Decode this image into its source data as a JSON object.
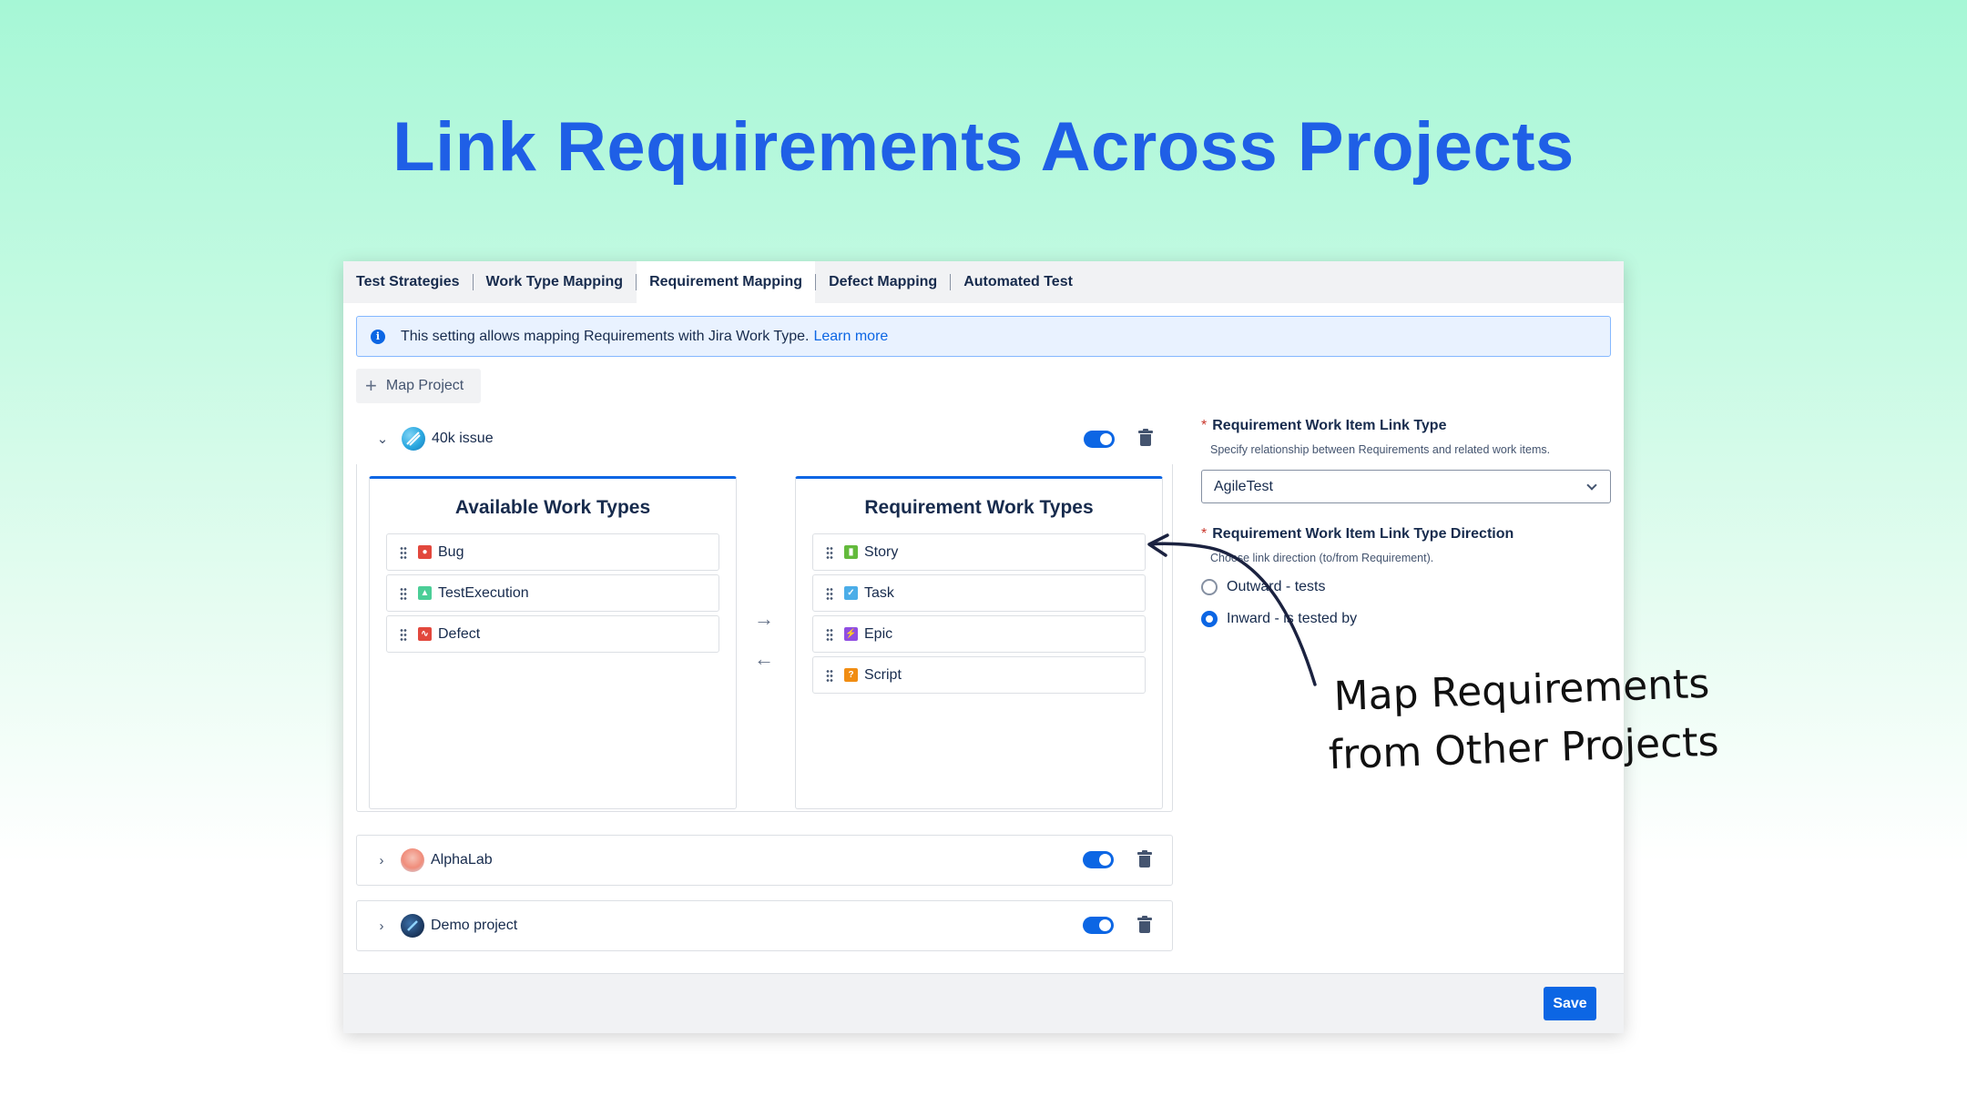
{
  "headline": "Link Requirements Across Projects",
  "tabs": [
    {
      "label": "Test Strategies",
      "active": false
    },
    {
      "label": "Work Type Mapping",
      "active": false
    },
    {
      "label": "Requirement Mapping",
      "active": true
    },
    {
      "label": "Defect Mapping",
      "active": false
    },
    {
      "label": "Automated Test",
      "active": false
    }
  ],
  "info_banner": {
    "text": "This setting allows mapping Requirements with Jira Work Type.",
    "link": "Learn more",
    "icon": "info-icon"
  },
  "map_project_button": "Map Project",
  "projects": [
    {
      "name": "40k issue",
      "expanded": true,
      "enabled": true
    },
    {
      "name": "AlphaLab",
      "expanded": false,
      "enabled": true
    },
    {
      "name": "Demo project",
      "expanded": false,
      "enabled": true
    }
  ],
  "available_work_types": {
    "title": "Available Work Types",
    "items": [
      {
        "label": "Bug",
        "icon": "bug-icon",
        "color": "#e2483d"
      },
      {
        "label": "TestExecution",
        "icon": "test-execution-icon",
        "color": "#4bce97"
      },
      {
        "label": "Defect",
        "icon": "defect-icon",
        "color": "#e2483d"
      }
    ]
  },
  "requirement_work_types": {
    "title": "Requirement Work Types",
    "items": [
      {
        "label": "Story",
        "icon": "story-icon",
        "color": "#63ba3c"
      },
      {
        "label": "Task",
        "icon": "task-icon",
        "color": "#4bade8"
      },
      {
        "label": "Epic",
        "icon": "epic-icon",
        "color": "#904ee2"
      },
      {
        "label": "Script",
        "icon": "script-icon",
        "color": "#f18d13"
      }
    ]
  },
  "link_type": {
    "label": "Requirement Work Item Link Type",
    "help": "Specify relationship between Requirements and related work items.",
    "value": "AgileTest"
  },
  "link_direction": {
    "label": "Requirement Work Item Link Type Direction",
    "help": "Choose link direction (to/from Requirement).",
    "options": [
      {
        "label": "Outward - tests",
        "selected": false
      },
      {
        "label": "Inward - is tested by",
        "selected": true
      }
    ]
  },
  "save_button": "Save",
  "annotation": {
    "line1": "Map Requirements",
    "line2": "from Other Projects"
  },
  "colors": {
    "headline": "#1f5fe6",
    "primary": "#0c66e4"
  }
}
